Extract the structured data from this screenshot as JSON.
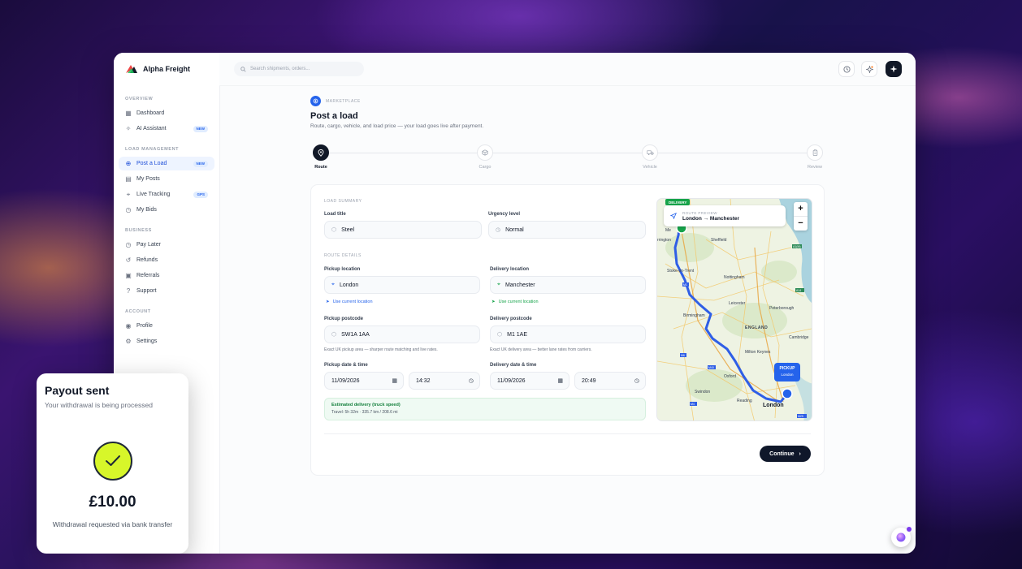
{
  "brand": {
    "name": "Alpha Freight"
  },
  "search": {
    "placeholder": "Search shipments, orders..."
  },
  "sidebar": {
    "sections": [
      {
        "title": "OVERVIEW",
        "items": [
          {
            "label": "Dashboard",
            "icon": "grid-icon"
          },
          {
            "label": "AI Assistant",
            "icon": "sparkle-icon",
            "badge": "NEW"
          }
        ]
      },
      {
        "title": "LOAD MANAGEMENT",
        "items": [
          {
            "label": "Post a Load",
            "icon": "plus-circle-icon",
            "badge": "NEW",
            "active": true
          },
          {
            "label": "My Posts",
            "icon": "document-icon"
          },
          {
            "label": "Live Tracking",
            "icon": "location-pin-icon",
            "badge": "GPS"
          },
          {
            "label": "My Bids",
            "icon": "clock-icon"
          }
        ]
      },
      {
        "title": "BUSINESS",
        "items": [
          {
            "label": "Pay Later",
            "icon": "clock-icon"
          },
          {
            "label": "Refunds",
            "icon": "refresh-icon"
          },
          {
            "label": "Referrals",
            "icon": "gift-icon"
          },
          {
            "label": "Support",
            "icon": "help-icon"
          }
        ]
      },
      {
        "title": "ACCOUNT",
        "items": [
          {
            "label": "Profile",
            "icon": "user-icon"
          },
          {
            "label": "Settings",
            "icon": "gear-icon"
          }
        ]
      }
    ]
  },
  "page": {
    "breadcrumb": "MARKETPLACE",
    "title": "Post a load",
    "subtitle": "Route, cargo, vehicle, and load price — your load goes live after payment."
  },
  "steps": [
    {
      "label": "Route",
      "icon": "location-pin-icon",
      "active": true
    },
    {
      "label": "Cargo",
      "icon": "box-icon"
    },
    {
      "label": "Vehicle",
      "icon": "truck-icon"
    },
    {
      "label": "Review",
      "icon": "clipboard-icon"
    }
  ],
  "form": {
    "load_summary_title": "LOAD SUMMARY",
    "load_title_label": "Load title",
    "load_title_value": "Steel",
    "urgency_label": "Urgency level",
    "urgency_value": "Normal",
    "route_details_title": "ROUTE DETAILS",
    "pickup_location_label": "Pickup location",
    "pickup_location_value": "London",
    "delivery_location_label": "Delivery location",
    "delivery_location_value": "Manchester",
    "use_current_location": "Use current location",
    "pickup_postcode_label": "Pickup postcode",
    "pickup_postcode_value": "SW1A 1AA",
    "delivery_postcode_label": "Delivery postcode",
    "delivery_postcode_value": "M1 1AE",
    "pickup_postcode_hint": "Exact UK pickup area — sharper route matching and live rates.",
    "delivery_postcode_hint": "Exact UK delivery area — better lane rates from carriers.",
    "pickup_datetime_label": "Pickup date & time",
    "pickup_date": "11/09/2026",
    "pickup_time": "14:32",
    "delivery_datetime_label": "Delivery date & time",
    "delivery_date": "11/09/2026",
    "delivery_time": "20:49",
    "estimate_title": "Estimated delivery (truck speed)",
    "estimate_detail": "Travel: 5h 32m · 335.7 km / 208.6 mi",
    "continue_label": "Continue"
  },
  "map": {
    "preview_label": "ROUTE PREVIEW",
    "preview_route": "London → Manchester",
    "delivery_tag": "DELIVERY",
    "pickup_tag": "PICKUP",
    "pickup_city": "London",
    "zoom_in": "+",
    "zoom_out": "−",
    "places": [
      {
        "name": "Sheffield"
      },
      {
        "name": "Stoke-on-Trent"
      },
      {
        "name": "Nottingham"
      },
      {
        "name": "Leicester"
      },
      {
        "name": "Peterborough"
      },
      {
        "name": "Birmingham"
      },
      {
        "name": "ENGLAND"
      },
      {
        "name": "Cambridge"
      },
      {
        "name": "Milton Keynes"
      },
      {
        "name": "Oxford"
      },
      {
        "name": "Swindon"
      },
      {
        "name": "Reading"
      },
      {
        "name": "London"
      },
      {
        "name": "rrington"
      },
      {
        "name": "Me"
      },
      {
        "name": "Lu"
      }
    ],
    "road_labels": [
      "A1(M)",
      "M1",
      "M6",
      "M40",
      "M4",
      "M25",
      "A14"
    ]
  },
  "payout": {
    "title": "Payout sent",
    "subtitle": "Your withdrawal is being processed",
    "amount": "£10.00",
    "note": "Withdrawal requested via bank transfer"
  },
  "colors": {
    "accent": "#2563eb",
    "success": "#16a34a",
    "check": "#d7f62a",
    "dark": "#0f172a"
  }
}
